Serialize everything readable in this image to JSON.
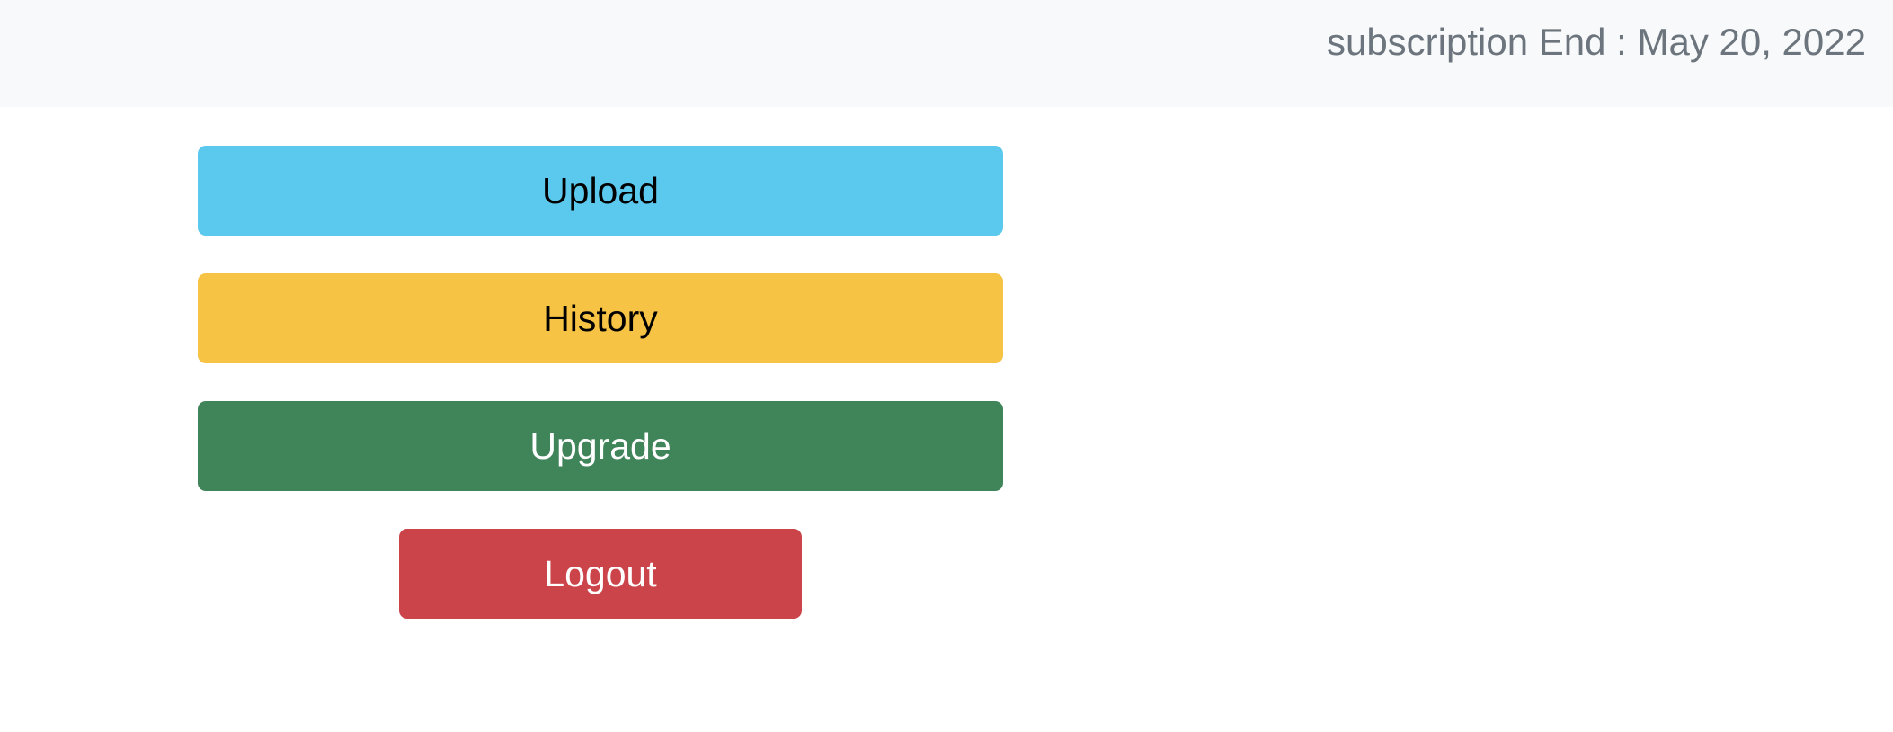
{
  "header": {
    "subscription_text": "subscription End : May 20, 2022"
  },
  "actions": {
    "upload_label": "Upload",
    "history_label": "History",
    "upgrade_label": "Upgrade",
    "logout_label": "Logout"
  },
  "colors": {
    "upload": "#5bc8ed",
    "history": "#f6c344",
    "upgrade": "#40855a",
    "logout": "#cb444a",
    "header_bg": "#f8f9fa",
    "header_text": "#6c757d"
  }
}
